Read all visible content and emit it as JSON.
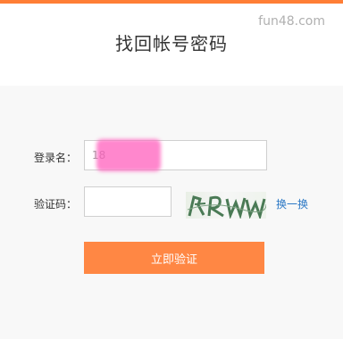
{
  "page": {
    "title": "找回帐号密码",
    "watermark": "fun48.com"
  },
  "form": {
    "username_label": "登录名：",
    "username_value": "18",
    "captcha_label": "验证码：",
    "captcha_value": "",
    "refresh_label": "换一换",
    "submit_label": "立即验证"
  },
  "colors": {
    "accent": "#ff8744",
    "link": "#2b78c5",
    "background": "#f8f8f8"
  }
}
